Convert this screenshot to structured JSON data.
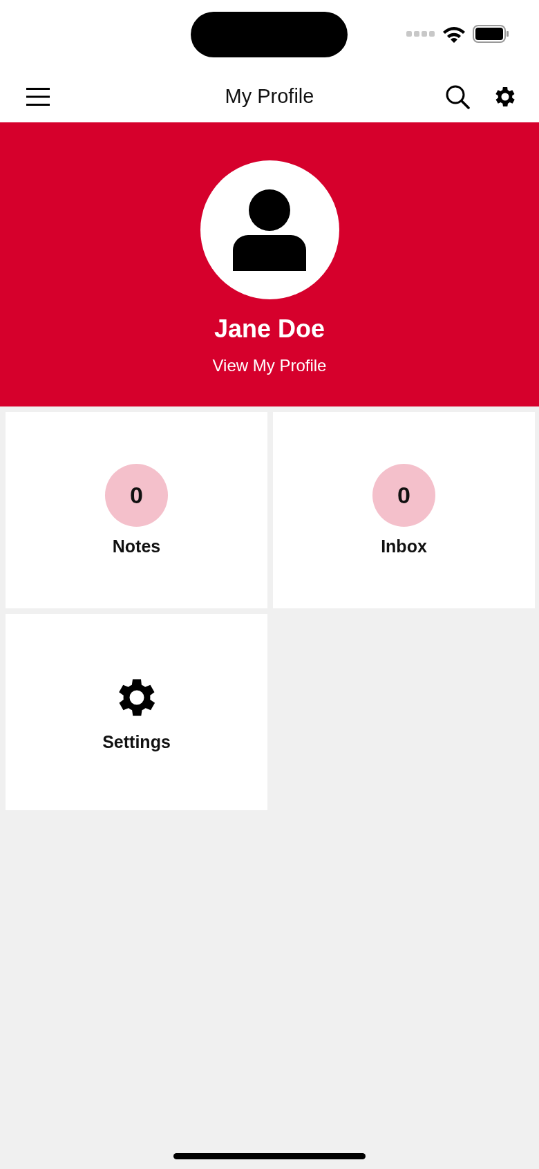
{
  "header": {
    "title": "My Profile"
  },
  "profile": {
    "name": "Jane Doe",
    "link": "View My Profile"
  },
  "tiles": [
    {
      "kind": "counter",
      "count": "0",
      "label": "Notes"
    },
    {
      "kind": "counter",
      "count": "0",
      "label": "Inbox"
    },
    {
      "kind": "icon",
      "label": "Settings"
    }
  ]
}
